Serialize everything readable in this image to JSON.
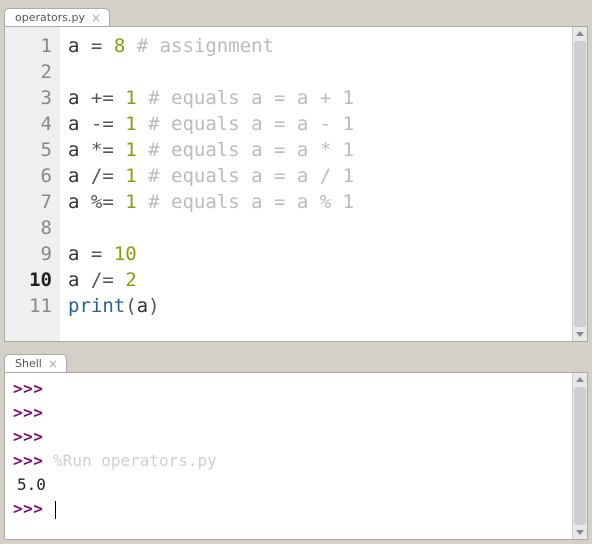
{
  "editor": {
    "tab_label": "operators.py",
    "lines": [
      {
        "n": "1",
        "var": "a",
        "op": "=",
        "num": "8",
        "comment": "# assignment"
      },
      {
        "n": "2"
      },
      {
        "n": "3",
        "var": "a",
        "op": "+=",
        "num": "1",
        "comment": "# equals a = a + 1"
      },
      {
        "n": "4",
        "var": "a",
        "op": "-=",
        "num": "1",
        "comment": "# equals a = a - 1"
      },
      {
        "n": "5",
        "var": "a",
        "op": "*=",
        "num": "1",
        "comment": "# equals a = a * 1"
      },
      {
        "n": "6",
        "var": "a",
        "op": "/=",
        "num": "1",
        "comment": "# equals a = a / 1"
      },
      {
        "n": "7",
        "var": "a",
        "op": "%=",
        "num": "1",
        "comment": "# equals a = a % 1"
      },
      {
        "n": "8"
      },
      {
        "n": "9",
        "var": "a",
        "op": "=",
        "num": "10"
      },
      {
        "n": "10",
        "var": "a",
        "op": "/=",
        "num": "2",
        "current": true
      },
      {
        "n": "11",
        "func": "print",
        "arg": "a"
      }
    ]
  },
  "shell": {
    "tab_label": "Shell",
    "prompt": ">>>",
    "run_text": "%Run operators.py",
    "output": "5.0"
  }
}
